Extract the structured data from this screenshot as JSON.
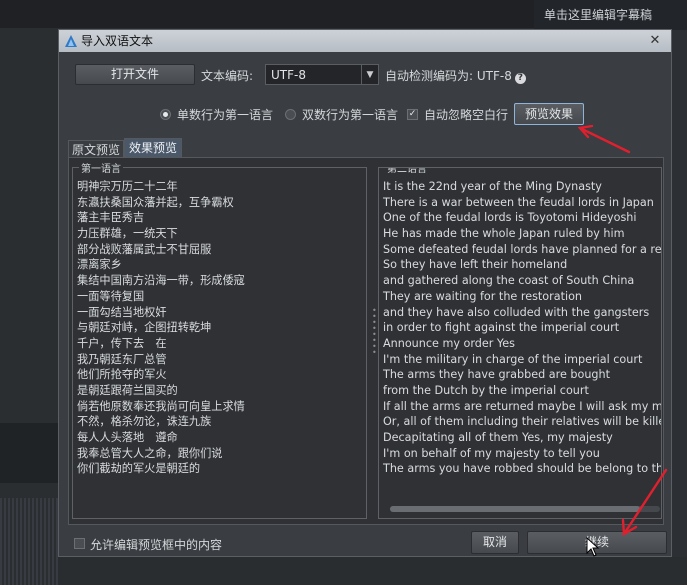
{
  "background": {
    "hint_text": "单击这里编辑字幕稿"
  },
  "dialog": {
    "title": "导入双语文本",
    "close_icon": "close-icon",
    "open_file_label": "打开文件",
    "encoding_label": "文本编码:",
    "encoding_value": "UTF-8",
    "auto_detect_label": "自动检测编码为: UTF-8",
    "option_odd_first": "单数行为第一语言",
    "option_even_first": "双数行为第一语言",
    "option_ignore_blank": "自动忽略空白行",
    "preview_button": "预览效果",
    "selected_option": "单数行为第一语言",
    "ignore_blank_checked": true,
    "tabs": [
      "原文预览",
      "效果预览"
    ],
    "active_tab": "效果预览",
    "first_language_title": "第一语言",
    "second_language_title": "第二语言",
    "first_language_lines": [
      "明神宗万历二十二年",
      "东瀛扶桑国众藩并起，互争霸权",
      "藩主丰臣秀吉",
      "力压群雄，一统天下",
      "部分战败藩属武士不甘屈服",
      "漂离家乡",
      "集结中国南方沿海一带，形成倭寇",
      "一面等待复国",
      "一面勾结当地权奸",
      "与朝廷对峙，企图扭转乾坤",
      "千户，传下去　在",
      "我乃朝廷东厂总管",
      "他们所抢夺的军火",
      "是朝廷跟荷兰国买的",
      "倘若他原数奉还我尚可向皇上求情",
      "不然，格杀勿论，诛连九族",
      "每人人头落地　遵命",
      "我奉总管大人之命，跟你们说",
      "你们截劫的军火是朝廷的"
    ],
    "second_language_lines": [
      "It is the 22nd year of the Ming Dynasty",
      "There is a war between the feudal lords in Japan",
      "One of the feudal lords is Toyotomi Hideyoshi",
      "He has made the whole Japan ruled by him",
      "Some defeated feudal lords have planned for a reb",
      "So they have left their homeland",
      "and gathered along the coast of South China",
      "They are waiting for the restoration",
      "and they have also colluded with the gangsters",
      "in order to fight against the imperial court",
      "Announce my order Yes",
      "I'm the military in charge of the imperial court",
      "The arms they have grabbed are bought",
      "from the Dutch by the imperial court",
      "If all the arms are returned maybe I will ask my ma",
      "Or, all of them including their relatives will be kille",
      "Decapitating all of them Yes, my majesty",
      "I'm on behalf of my majesty to tell you",
      "The arms you have robbed should be belong to th"
    ],
    "allow_edit_label": "允许编辑预览框中的内容",
    "allow_edit_checked": false,
    "cancel_label": "取消",
    "continue_label": "继续"
  },
  "annotation_color": "#e0202e"
}
